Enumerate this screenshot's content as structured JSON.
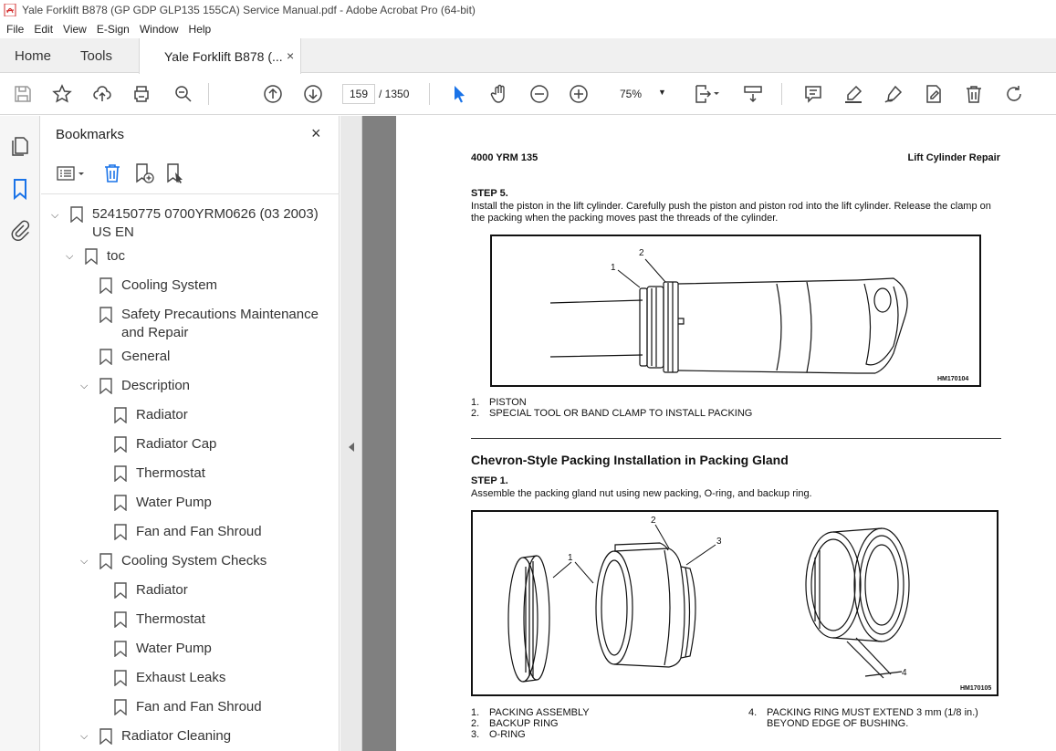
{
  "window": {
    "title": "Yale Forklift B878 (GP GDP GLP135 155CA) Service Manual.pdf - Adobe Acrobat Pro (64-bit)"
  },
  "menu": [
    "File",
    "Edit",
    "View",
    "E-Sign",
    "Window",
    "Help"
  ],
  "tabs": {
    "home": "Home",
    "tools": "Tools",
    "doc": "Yale Forklift B878 (...",
    "close": "×"
  },
  "toolbar": {
    "page_current": "159",
    "page_total": "/ 1350",
    "zoom": "75%",
    "icons": [
      "save-icon",
      "star-icon",
      "upload-icon",
      "print-icon",
      "zoom-search-icon",
      "prev-page-icon",
      "next-page-icon",
      "select-cursor-icon",
      "hand-icon",
      "zoom-out-icon",
      "zoom-in-icon",
      "fit-page-icon",
      "scroll-mode-icon",
      "comment-icon",
      "highlight-icon",
      "sign-icon",
      "edit-icon",
      "delete-icon",
      "rotate-icon"
    ]
  },
  "bookmarks": {
    "title": "Bookmarks",
    "close": "×",
    "items": [
      {
        "text": "524150775 0700YRM0626 (03 2003)",
        "text2": "US EN",
        "level": 0,
        "expanded": true
      },
      {
        "text": "toc",
        "level": 1,
        "expanded": true
      },
      {
        "text": "Cooling System",
        "level": 2
      },
      {
        "text": "Safety Precautions Maintenance",
        "text2": "and Repair",
        "level": 2
      },
      {
        "text": "General",
        "level": 2
      },
      {
        "text": "Description",
        "level": 2,
        "expanded": true
      },
      {
        "text": "Radiator",
        "level": 3
      },
      {
        "text": "Radiator Cap",
        "level": 3
      },
      {
        "text": "Thermostat",
        "level": 3
      },
      {
        "text": "Water Pump",
        "level": 3
      },
      {
        "text": "Fan and Fan Shroud",
        "level": 3
      },
      {
        "text": "Cooling System Checks",
        "level": 2,
        "expanded": true
      },
      {
        "text": "Radiator",
        "level": 3
      },
      {
        "text": "Thermostat",
        "level": 3
      },
      {
        "text": "Water Pump",
        "level": 3
      },
      {
        "text": "Exhaust Leaks",
        "level": 3
      },
      {
        "text": "Fan and Fan Shroud",
        "level": 3
      },
      {
        "text": "Radiator Cleaning",
        "level": 2,
        "expanded": true
      }
    ]
  },
  "page": {
    "header_left": "4000 YRM 135",
    "header_right": "Lift Cylinder Repair",
    "step5_title": "STEP 5.",
    "step5_text": "Install the piston in the lift cylinder. Carefully push the piston and piston rod into the lift cylinder. Release the clamp on the packing when the packing moves past the threads of the cylinder.",
    "fig1_code": "HM170104",
    "fig1_callouts": [
      "1",
      "2"
    ],
    "fig1_legend": [
      {
        "n": "1.",
        "t": "PISTON"
      },
      {
        "n": "2.",
        "t": "SPECIAL TOOL OR BAND CLAMP TO INSTALL PACKING"
      }
    ],
    "section_heading": "Chevron-Style Packing Installation in Packing Gland",
    "step1_title": "STEP 1.",
    "step1_text": "Assemble the packing gland nut using new packing, O-ring, and backup ring.",
    "fig2_code": "HM170105",
    "fig2_callouts": [
      "1",
      "2",
      "3",
      "4"
    ],
    "fig2_legend_left": [
      {
        "n": "1.",
        "t": "PACKING ASSEMBLY"
      },
      {
        "n": "2.",
        "t": "BACKUP RING"
      },
      {
        "n": "3.",
        "t": "O-RING"
      }
    ],
    "fig2_legend_right": [
      {
        "n": "4.",
        "t": "PACKING RING MUST EXTEND 3 mm (1/8 in.)"
      },
      {
        "n": "",
        "t": "BEYOND EDGE OF BUSHING."
      }
    ]
  }
}
